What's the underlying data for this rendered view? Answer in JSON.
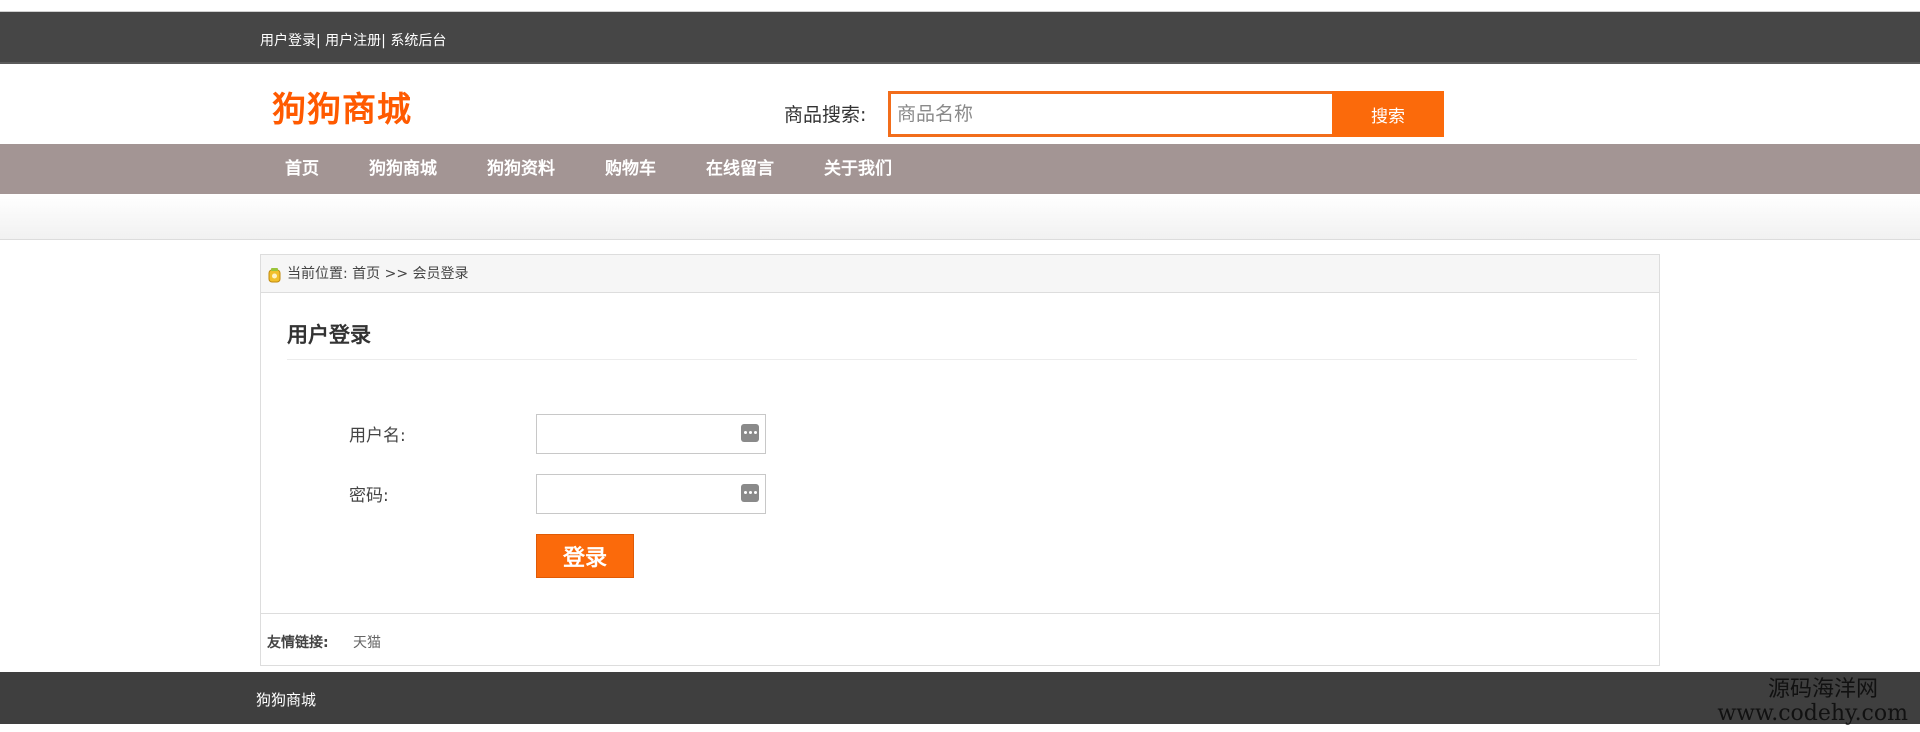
{
  "top_bar": {
    "links": [
      "用户登录",
      "用户注册",
      "系统后台"
    ],
    "separator": "| "
  },
  "header": {
    "logo": "狗狗商城",
    "search_label": "商品搜索:",
    "search_placeholder": "商品名称",
    "search_button": "搜索"
  },
  "nav": {
    "items": [
      "首页",
      "狗狗商城",
      "狗狗资料",
      "购物车",
      "在线留言",
      "关于我们"
    ]
  },
  "breadcrumb": {
    "prefix": "当前位置:",
    "path": "首页 >> 会员登录"
  },
  "login": {
    "title": "用户登录",
    "username_label": "用户名:",
    "password_label": "密码:",
    "submit": "登录"
  },
  "friend_links": {
    "label": "友情链接:",
    "items": [
      "天猫"
    ]
  },
  "footer": {
    "text": "狗狗商城",
    "watermark_line1": "源码海洋网",
    "watermark_line2": "www.codehy.com"
  },
  "colors": {
    "accent": "#fb6a0b",
    "logo": "#ff5a00",
    "top_bar": "#464646",
    "nav_bar": "#a39594",
    "footer": "#3f3f3f"
  }
}
